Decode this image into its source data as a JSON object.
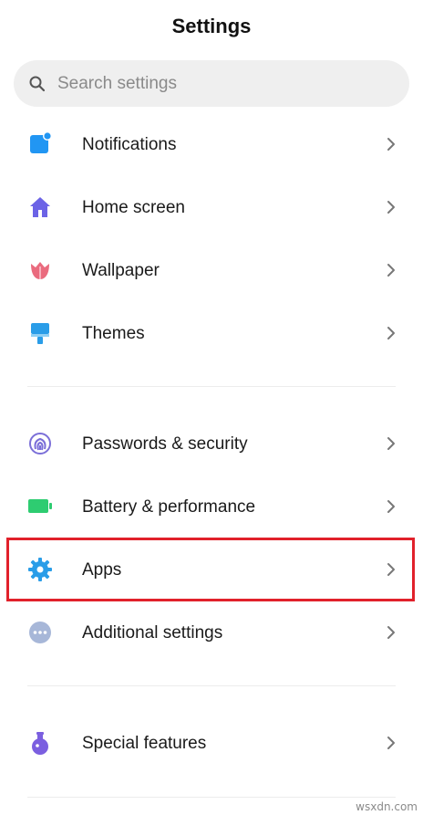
{
  "header": {
    "title": "Settings"
  },
  "search": {
    "placeholder": "Search settings",
    "value": "",
    "icon": "search-icon"
  },
  "groups": [
    {
      "items": [
        {
          "label": "Notifications",
          "icon": "notifications-icon",
          "color": "#2196f3"
        },
        {
          "label": "Home screen",
          "icon": "home-icon",
          "color": "#6c63e6"
        },
        {
          "label": "Wallpaper",
          "icon": "tulip-icon",
          "color": "#ea6b7e"
        },
        {
          "label": "Themes",
          "icon": "paintbrush-icon",
          "color": "#2a9de8"
        }
      ]
    },
    {
      "items": [
        {
          "label": "Passwords & security",
          "icon": "fingerprint-icon",
          "color": "#7b6fd8"
        },
        {
          "label": "Battery & performance",
          "icon": "battery-icon",
          "color": "#2ecc71"
        },
        {
          "label": "Apps",
          "icon": "gear-icon",
          "color": "#2a9de8",
          "highlighted": true
        },
        {
          "label": "Additional settings",
          "icon": "more-dots-icon",
          "color": "#a7b7d8"
        }
      ]
    },
    {
      "items": [
        {
          "label": "Special features",
          "icon": "flask-icon",
          "color": "#7b5fe0"
        }
      ]
    }
  ],
  "highlight_color": "#e1212b",
  "watermark": "wsxdn.com"
}
